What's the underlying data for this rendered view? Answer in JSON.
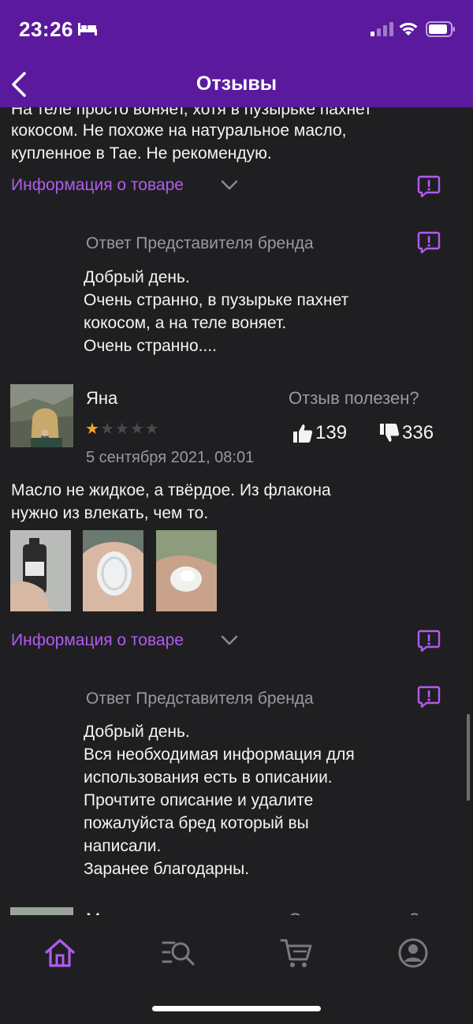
{
  "status_bar": {
    "time": "23:26"
  },
  "header": {
    "title": "Отзывы"
  },
  "review_prev": {
    "text_lines": [
      "На теле просто воняет, хотя в пузырьке пахнет",
      "кокосом. Не похоже на натуральное масло,",
      "купленное в Тае. Не рекомендую."
    ],
    "product_info_label": "Информация о товаре"
  },
  "brand_reply_1": {
    "label": "Ответ Представителя бренда",
    "text_lines": [
      "Добрый день.",
      "Очень странно, в пузырьке пахнет",
      "кокосом, а на теле воняет.",
      "Очень странно...."
    ]
  },
  "review_yana": {
    "author": "Яна",
    "rating": 1,
    "rating_max": 5,
    "date": "5 сентября 2021, 08:01",
    "helpful_label": "Отзыв полезен?",
    "likes": "139",
    "dislikes": "336",
    "text_lines": [
      "Масло не жидкое, а твёрдое. Из флакона",
      "нужно из влекать, чем то."
    ],
    "photo_count": 3,
    "product_info_label": "Информация о товаре"
  },
  "brand_reply_2": {
    "label": "Ответ Представителя бренда",
    "text_lines": [
      "Добрый день.",
      "Вся необходимая информация для",
      "использования есть в описании.",
      "Прочтите описание и удалите",
      "пожалуйста бред который вы",
      "написали.",
      "Заранее благодарны."
    ]
  },
  "review_next": {
    "author": "Марина",
    "helpful_label": "Отзыв полезен?"
  },
  "tab_bar": {
    "items": [
      "home-icon",
      "catalog-search-icon",
      "cart-icon",
      "profile-icon"
    ],
    "active": "home-icon"
  },
  "colors": {
    "header_bg": "#5b1a9e",
    "accent": "#b15bf0",
    "background": "#1f1f21",
    "star": "#f5a623"
  }
}
